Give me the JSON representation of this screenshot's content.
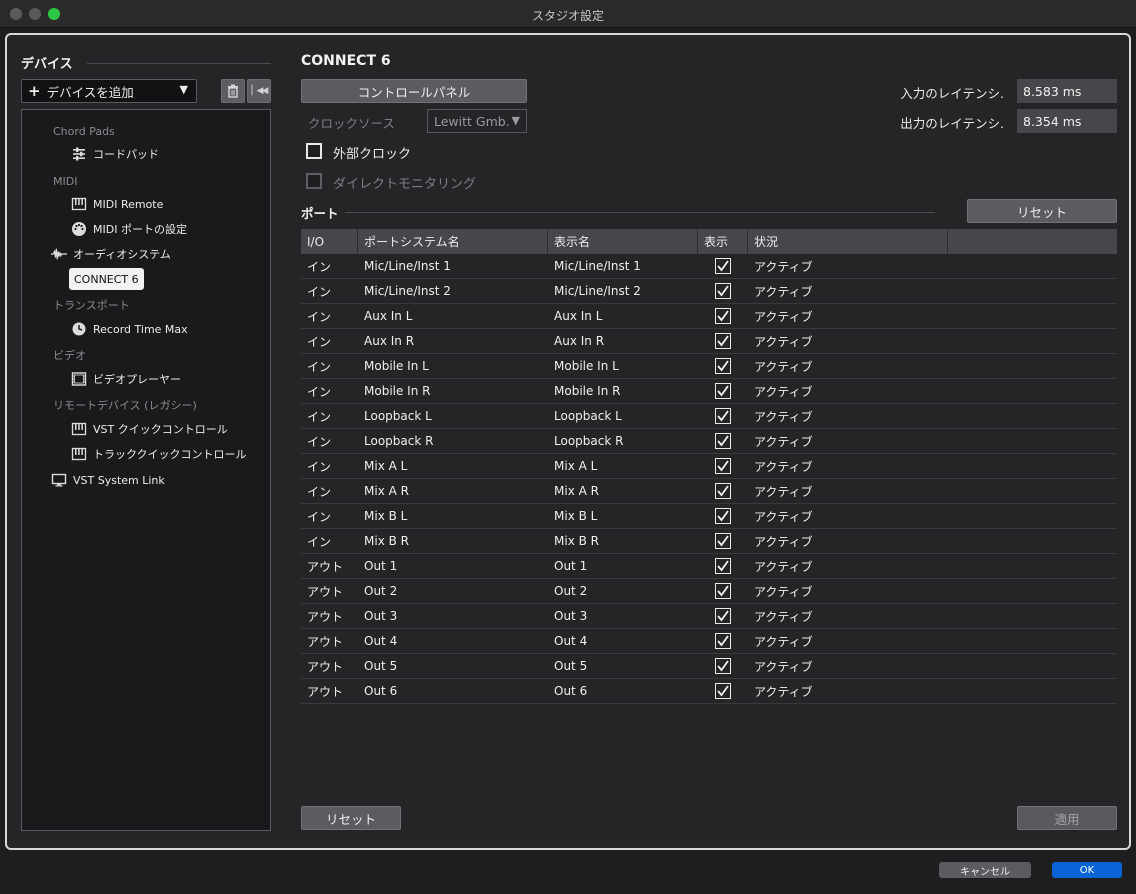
{
  "window": {
    "title": "スタジオ設定"
  },
  "sidebar": {
    "title": "デバイス",
    "add_device_label": "デバイスを追加",
    "tree": [
      {
        "label": "Chord Pads",
        "kind": "category"
      },
      {
        "label": "コードパッド",
        "kind": "item",
        "icon": "sliders-icon"
      },
      {
        "label": "MIDI",
        "kind": "category"
      },
      {
        "label": "MIDI Remote",
        "kind": "item",
        "icon": "keyboard-icon"
      },
      {
        "label": "MIDI ポートの設定",
        "kind": "item",
        "icon": "midi-port-icon"
      },
      {
        "label": "オーディオシステム",
        "kind": "item",
        "icon": "waveform-icon"
      },
      {
        "label": "CONNECT 6",
        "kind": "selected"
      },
      {
        "label": "トランスポート",
        "kind": "category"
      },
      {
        "label": "Record Time Max",
        "kind": "item",
        "icon": "clock-icon"
      },
      {
        "label": "ビデオ",
        "kind": "category"
      },
      {
        "label": "ビデオプレーヤー",
        "kind": "item",
        "icon": "film-icon"
      },
      {
        "label": "リモートデバイス (レガシー)",
        "kind": "category"
      },
      {
        "label": "VST クイックコントロール",
        "kind": "item",
        "icon": "keyboard-icon"
      },
      {
        "label": "トラッククイックコントロール",
        "kind": "item",
        "icon": "keyboard-icon"
      },
      {
        "label": "VST System Link",
        "kind": "item",
        "icon": "monitor-icon"
      }
    ]
  },
  "main": {
    "device_title": "CONNECT 6",
    "control_panel_label": "コントロールパネル",
    "clock_source_label": "クロックソース",
    "clock_source_value": "Lewitt Gmb.",
    "external_clock_label": "外部クロック",
    "direct_monitoring_label": "ダイレクトモニタリング",
    "input_latency_label": "入力のレイテンシ.",
    "input_latency_value": "8.583 ms",
    "output_latency_label": "出力のレイテンシ.",
    "output_latency_value": "8.354 ms",
    "ports_label": "ポート",
    "reset_label": "リセット",
    "table": {
      "headers": [
        "I/O",
        "ポートシステム名",
        "表示名",
        "表示",
        "状況",
        ""
      ],
      "rows": [
        {
          "io": "イン",
          "system": "Mic/Line/Inst 1",
          "display": "Mic/Line/Inst 1",
          "shown": true,
          "status": "アクティブ"
        },
        {
          "io": "イン",
          "system": "Mic/Line/Inst 2",
          "display": "Mic/Line/Inst 2",
          "shown": true,
          "status": "アクティブ"
        },
        {
          "io": "イン",
          "system": "Aux In L",
          "display": "Aux In L",
          "shown": true,
          "status": "アクティブ"
        },
        {
          "io": "イン",
          "system": "Aux In R",
          "display": "Aux In R",
          "shown": true,
          "status": "アクティブ"
        },
        {
          "io": "イン",
          "system": "Mobile In L",
          "display": "Mobile In L",
          "shown": true,
          "status": "アクティブ"
        },
        {
          "io": "イン",
          "system": "Mobile In R",
          "display": "Mobile In R",
          "shown": true,
          "status": "アクティブ"
        },
        {
          "io": "イン",
          "system": "Loopback L",
          "display": "Loopback L",
          "shown": true,
          "status": "アクティブ"
        },
        {
          "io": "イン",
          "system": "Loopback R",
          "display": "Loopback R",
          "shown": true,
          "status": "アクティブ"
        },
        {
          "io": "イン",
          "system": "Mix A L",
          "display": "Mix A L",
          "shown": true,
          "status": "アクティブ"
        },
        {
          "io": "イン",
          "system": "Mix A R",
          "display": "Mix A R",
          "shown": true,
          "status": "アクティブ"
        },
        {
          "io": "イン",
          "system": "Mix B L",
          "display": "Mix B L",
          "shown": true,
          "status": "アクティブ"
        },
        {
          "io": "イン",
          "system": "Mix B R",
          "display": "Mix B R",
          "shown": true,
          "status": "アクティブ"
        },
        {
          "io": "アウト",
          "system": "Out 1",
          "display": "Out 1",
          "shown": true,
          "status": "アクティブ"
        },
        {
          "io": "アウト",
          "system": "Out 2",
          "display": "Out 2",
          "shown": true,
          "status": "アクティブ"
        },
        {
          "io": "アウト",
          "system": "Out 3",
          "display": "Out 3",
          "shown": true,
          "status": "アクティブ"
        },
        {
          "io": "アウト",
          "system": "Out 4",
          "display": "Out 4",
          "shown": true,
          "status": "アクティブ"
        },
        {
          "io": "アウト",
          "system": "Out 5",
          "display": "Out 5",
          "shown": true,
          "status": "アクティブ"
        },
        {
          "io": "アウト",
          "system": "Out 6",
          "display": "Out 6",
          "shown": true,
          "status": "アクティブ"
        }
      ]
    },
    "bottom_reset_label": "リセット",
    "apply_label": "適用"
  },
  "footer": {
    "cancel_label": "キャンセル",
    "ok_label": "OK"
  },
  "colors": {
    "accent": "#0a64d8",
    "panel": "#252528",
    "selected": "#f2f2f2"
  }
}
